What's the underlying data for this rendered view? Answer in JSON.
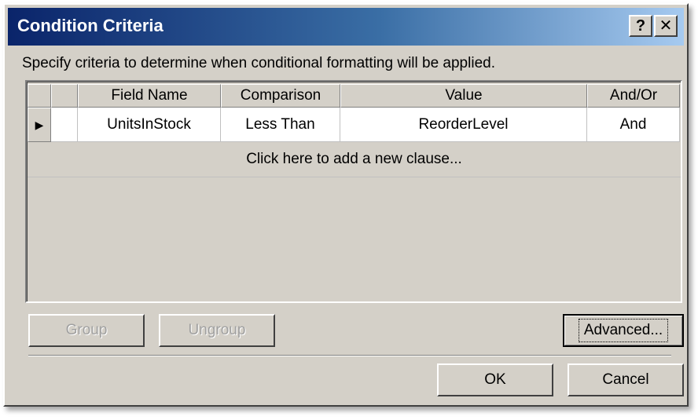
{
  "window": {
    "title": "Condition Criteria",
    "help_label": "?",
    "close_label": "✕"
  },
  "instructions": "Specify criteria to determine when conditional formatting will be applied.",
  "grid": {
    "columns": [
      "",
      "",
      "Field Name",
      "Comparison",
      "Value",
      "And/Or"
    ],
    "rows": [
      {
        "indicator": "▶",
        "field_name": "UnitsInStock",
        "comparison": "Less Than",
        "value": "ReorderLevel",
        "and_or": "And"
      }
    ],
    "add_clause_text": "Click here to add a new clause..."
  },
  "buttons": {
    "group": "Group",
    "ungroup": "Ungroup",
    "advanced": "Advanced...",
    "ok": "OK",
    "cancel": "Cancel"
  },
  "colors": {
    "titlebar_start": "#0a246a",
    "titlebar_end": "#a6caf0",
    "face": "#d4d0c8"
  }
}
